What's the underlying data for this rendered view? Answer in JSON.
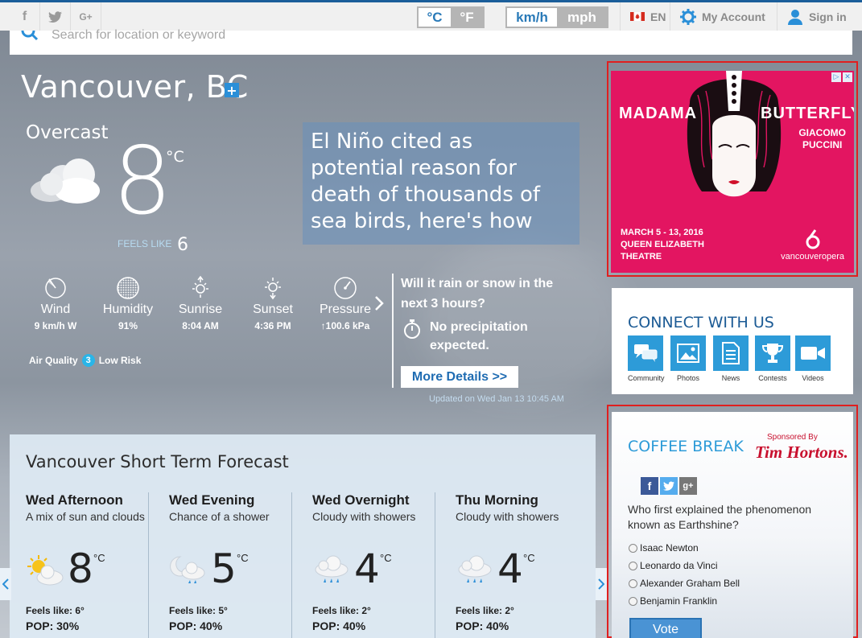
{
  "topbar": {
    "social": [
      "f",
      "t",
      "G+"
    ],
    "temp_units": {
      "active": "°C",
      "inactive": "°F"
    },
    "speed_units": {
      "active": "km/h",
      "inactive": "mph"
    },
    "language": "EN",
    "account_label": "My Account",
    "signin_label": "Sign in"
  },
  "search": {
    "placeholder": "Search for location or keyword"
  },
  "current": {
    "city": "Vancouver, BC",
    "condition": "Overcast",
    "temp": "8",
    "unit": "°C",
    "feels_label": "FEELS LIKE",
    "feels_value": "6",
    "stats": [
      {
        "label": "Wind",
        "value": "9 km/h W",
        "icon": "wind-icon"
      },
      {
        "label": "Humidity",
        "value": "91%",
        "icon": "humidity-icon"
      },
      {
        "label": "Sunrise",
        "value": "8:04 AM",
        "icon": "sunrise-icon"
      },
      {
        "label": "Sunset",
        "value": "4:36 PM",
        "icon": "sunset-icon"
      },
      {
        "label": "Pressure",
        "value": "100.6 kPa",
        "icon": "pressure-icon"
      }
    ],
    "air_quality_label": "Air Quality",
    "air_quality_index": "3",
    "air_quality_risk": "Low Risk",
    "rain_question": "Will it rain or snow in the next 3 hours?",
    "precip_text": "No precipitation expected.",
    "more_details": "More Details >>",
    "updated": "Updated on Wed Jan 13 10:45 AM"
  },
  "news": {
    "headline": "El Niño cited as potential reason for death of thousands of sea birds, here's how"
  },
  "forecast": {
    "title": "Vancouver Short Term Forecast",
    "periods": [
      {
        "name": "Wed Afternoon",
        "desc": "A mix of sun and clouds",
        "temp": "8",
        "deg": "°C",
        "feels": "Feels like: 6°",
        "pop": "POP: 30%",
        "icon": "sun-cloud-icon"
      },
      {
        "name": "Wed Evening",
        "desc": "Chance of a shower",
        "temp": "5",
        "deg": "°C",
        "feels": "Feels like: 5°",
        "pop": "POP: 40%",
        "icon": "moon-cloud-rain-icon"
      },
      {
        "name": "Wed Overnight",
        "desc": "Cloudy with showers",
        "temp": "4",
        "deg": "°C",
        "feels": "Feels like: 2°",
        "pop": "POP: 40%",
        "icon": "cloud-rain-icon"
      },
      {
        "name": "Thu Morning",
        "desc": "Cloudy with showers",
        "temp": "4",
        "deg": "°C",
        "feels": "Feels like: 2°",
        "pop": "POP: 40%",
        "icon": "cloud-rain-icon"
      }
    ]
  },
  "ad": {
    "title_left": "MADAMA",
    "title_right": "BUTTERFLY",
    "composer_line1": "GIACOMO",
    "composer_line2": "PUCCINI",
    "dates": "MARCH 5 - 13, 2016",
    "venue_line1": "QUEEN ELIZABETH",
    "venue_line2": "THEATRE",
    "sponsor_logo_text": "vancouveropera",
    "colors": {
      "background": "#e31561"
    }
  },
  "connect": {
    "title": "CONNECT WITH US",
    "items": [
      {
        "label": "Community",
        "icon": "community-icon"
      },
      {
        "label": "Photos",
        "icon": "photos-icon"
      },
      {
        "label": "News",
        "icon": "news-icon"
      },
      {
        "label": "Contests",
        "icon": "trophy-icon"
      },
      {
        "label": "Videos",
        "icon": "video-icon"
      }
    ]
  },
  "coffee": {
    "title": "COFFEE BREAK",
    "sponsored_by": "Sponsored By",
    "sponsor": "Tim Hortons.",
    "question": "Who first explained the phenomenon known as Earthshine?",
    "options": [
      "Isaac Newton",
      "Leonardo da Vinci",
      "Alexander Graham Bell",
      "Benjamin Franklin"
    ],
    "vote_label": "Vote"
  },
  "colors": {
    "accent": "#2a7ab8",
    "highlight_border": "#e01f1f",
    "panel": "#deeaf4"
  }
}
